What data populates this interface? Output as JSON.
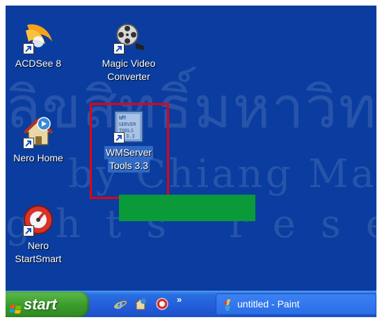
{
  "desktop": {
    "watermark_line1": "ลิขสิทธิ์มหาวิทยาลัยเชียงใหม่",
    "watermark_line2": "by Chiang Mai",
    "watermark_line3": "ghts reserved",
    "background_color": "#0a3d9f",
    "icons": [
      {
        "label_lines": [
          "ACDSee 8"
        ],
        "icon": "acdsee-icon"
      },
      {
        "label_lines": [
          "Magic Video",
          "Converter"
        ],
        "icon": "film-reel-icon"
      },
      {
        "label_lines": [
          "Nero Home"
        ],
        "icon": "nero-home-icon"
      },
      {
        "label_lines": [
          "WMServer",
          "Tools 3.3"
        ],
        "icon": "wmserver-tools-icon",
        "selected": true
      },
      {
        "label_lines": [
          "Nero",
          "StartSmart"
        ],
        "icon": "nero-startsmart-icon"
      }
    ],
    "highlight_color": "#e8000d",
    "green_bar_color": "#0a9a3a"
  },
  "taskbar": {
    "start_label": "start",
    "quick_launch": [
      "internet-explorer-icon",
      "nero-icon",
      "red-app-icon"
    ],
    "overflow_label": "»",
    "tasks": [
      {
        "label": "untitled - Paint",
        "icon": "paint-icon"
      }
    ]
  }
}
